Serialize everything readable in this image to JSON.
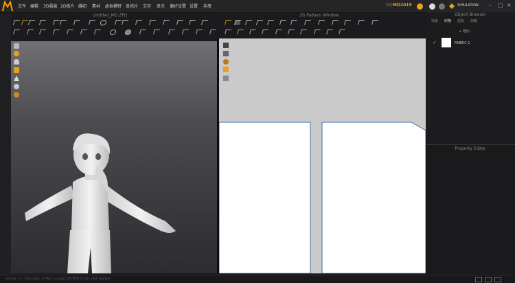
{
  "app": {
    "logo_icon": "marvelous-designer-logo-icon",
    "accent": "#f0a000",
    "version_label": "MD",
    "version_value": "MD2019",
    "simulation_label": "SIMULATION"
  },
  "menu": [
    "文件",
    "编辑",
    "3D服装",
    "2D板片",
    "缝纫",
    "素材",
    "虚拟模特",
    "显拓扑",
    "文字",
    "显示",
    "偏好设置",
    "设置",
    "手册"
  ],
  "viewports": {
    "left_title": "Untitled_MD.ZPrj",
    "right_title": "2D Pattern Window"
  },
  "object_browser": {
    "title": "Object Browser",
    "tabs": [
      "场景",
      "织物",
      "纽扣",
      "扣眼"
    ],
    "add_label": "+ 增加",
    "fabric_item": "FABRIC 1",
    "fabric_swatch": "#ffffff"
  },
  "property_editor": {
    "title": "Property Editor"
  },
  "status": {
    "text": "Vertex: 0 / Triangles: 0   Mem usage: 857MB   Cloth: Not loaded"
  }
}
